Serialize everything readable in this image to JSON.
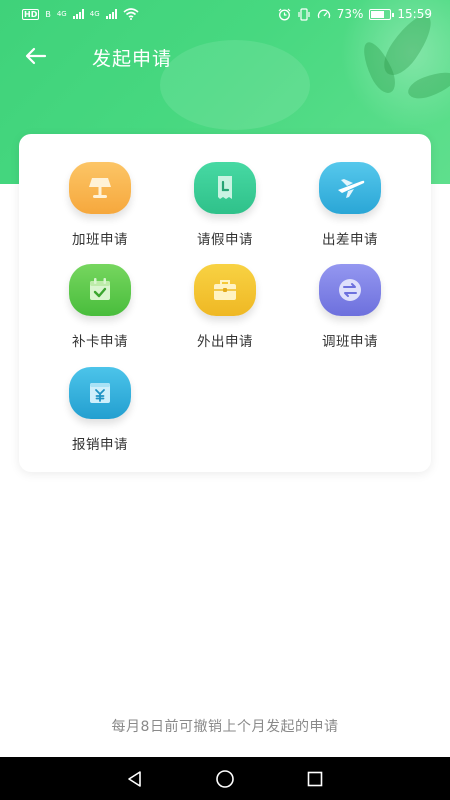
{
  "status_bar": {
    "left_label_hd": "HD",
    "left_label_b": "B",
    "left_4g_1": "4G",
    "left_4g_2": "4G",
    "battery_percent": "73%",
    "battery_level": 0.73,
    "time": "15:59"
  },
  "header": {
    "title": "发起申请",
    "colors": {
      "start": "#3fd27a",
      "end": "#5fdf8d"
    }
  },
  "apply_items": [
    {
      "label": "加班申请",
      "icon": "lamp-icon",
      "color": "#f9b652"
    },
    {
      "label": "请假申请",
      "icon": "leave-slip-icon",
      "color": "#3ecf98"
    },
    {
      "label": "出差申请",
      "icon": "airplane-icon",
      "color": "#39b7e0"
    },
    {
      "label": "补卡申请",
      "icon": "calendar-check-icon",
      "color": "#62cd4f"
    },
    {
      "label": "外出申请",
      "icon": "briefcase-icon",
      "color": "#f4c631"
    },
    {
      "label": "调班申请",
      "icon": "swap-icon",
      "color": "#7f83e6"
    },
    {
      "label": "报销申请",
      "icon": "reimburse-icon",
      "color": "#2fb4e0"
    }
  ],
  "footer": {
    "note": "每月8日前可撤销上个月发起的申请"
  }
}
